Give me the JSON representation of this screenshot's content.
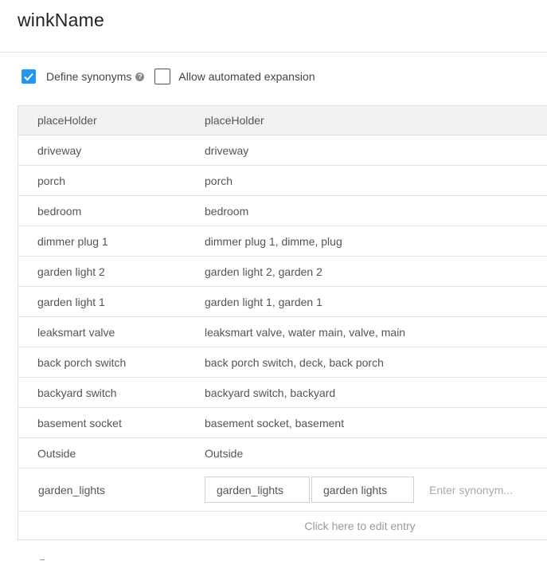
{
  "entity": {
    "title": "winkName"
  },
  "options": {
    "define_synonyms": {
      "label": "Define synonyms",
      "checked": true,
      "help_icon": "question-circle-icon"
    },
    "automated_expansion": {
      "label": "Allow automated expansion",
      "checked": false
    }
  },
  "table": {
    "header": {
      "reference": "placeHolder",
      "synonyms": "placeHolder"
    },
    "rows": [
      {
        "reference": "driveway",
        "synonyms": "driveway"
      },
      {
        "reference": "porch",
        "synonyms": "porch"
      },
      {
        "reference": "bedroom",
        "synonyms": "bedroom"
      },
      {
        "reference": "dimmer plug 1",
        "synonyms": "dimmer plug 1, dimme, plug"
      },
      {
        "reference": "garden light 2",
        "synonyms": "garden light 2, garden 2"
      },
      {
        "reference": "garden light 1",
        "synonyms": "garden light 1, garden 1"
      },
      {
        "reference": "leaksmart valve",
        "synonyms": "leaksmart valve, water main, valve, main"
      },
      {
        "reference": "back porch switch",
        "synonyms": "back porch switch, deck, back porch"
      },
      {
        "reference": "backyard switch",
        "synonyms": "backyard switch, backyard"
      },
      {
        "reference": "basement socket",
        "synonyms": "basement socket, basement"
      },
      {
        "reference": "Outside",
        "synonyms": "Outside"
      }
    ],
    "editing": {
      "reference": "garden_lights",
      "chips": [
        "garden_lights",
        "garden lights"
      ],
      "placeholder": "Enter synonym..."
    },
    "click_to_edit": "Click here to edit entry"
  },
  "colors": {
    "accent": "#2196f3",
    "header_bg": "#f2f2f2",
    "border": "#e0e0e0"
  }
}
